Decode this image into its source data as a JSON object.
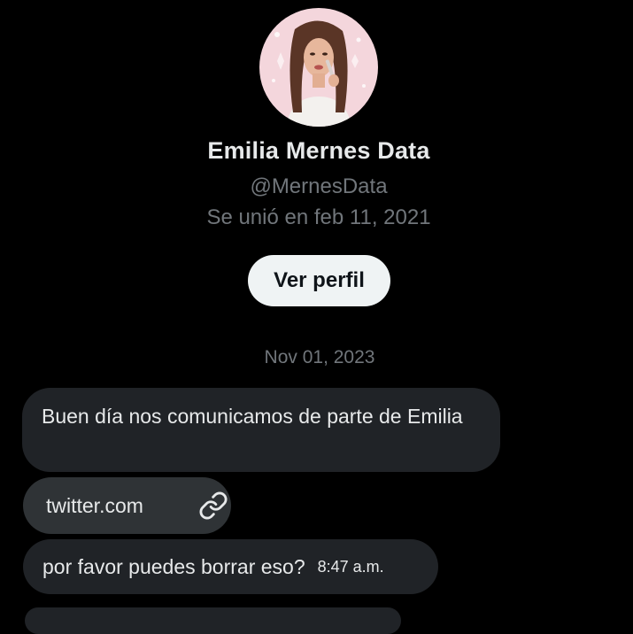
{
  "profile": {
    "name": "Emilia Mernes Data",
    "handle": "@MernesData",
    "joined": "Se unió en feb 11, 2021",
    "view_profile_label": "Ver perfil",
    "avatar_icon": "profile-photo"
  },
  "conversation": {
    "date_separator": "Nov 01, 2023",
    "messages": [
      {
        "type": "text",
        "text": "Buen día nos comunicamos de parte de Emilia"
      },
      {
        "type": "link",
        "text": "twitter.com",
        "icon": "link-icon"
      },
      {
        "type": "text",
        "text": "por favor puedes borrar eso?",
        "time": "8:47 a.m."
      }
    ]
  },
  "colors": {
    "background": "#000000",
    "bubble": "#202327",
    "link_chip": "#2f3336",
    "secondary_text": "#71767b",
    "primary_text": "#e7e9ea",
    "button_bg": "#eff3f4"
  }
}
